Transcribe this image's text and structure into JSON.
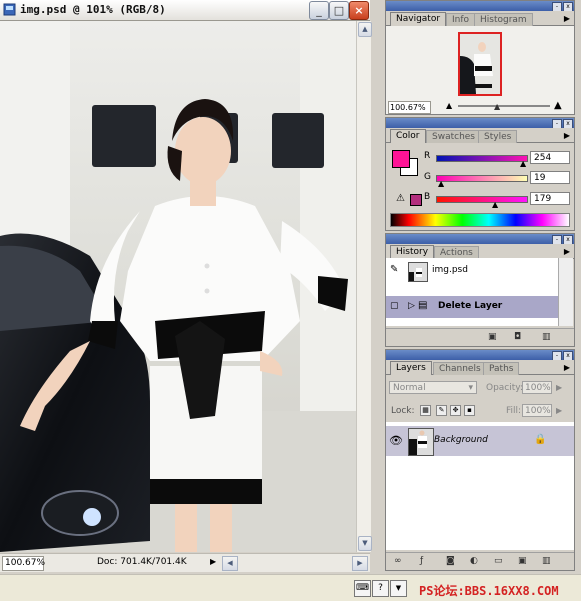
{
  "document": {
    "title": "img.psd @ 101% (RGB/8)",
    "zoom": "100.67%",
    "doc_size": "Doc: 701.4K/701.4K",
    "buttons": {
      "minimize": "_",
      "maximize": "□",
      "close": "×"
    }
  },
  "navigator": {
    "tabs": [
      "Navigator",
      "Info",
      "Histogram"
    ],
    "zoom": "100.67%"
  },
  "color": {
    "tabs": [
      "Color",
      "Swatches",
      "Styles"
    ],
    "channels": [
      {
        "label": "R",
        "value": "254"
      },
      {
        "label": "G",
        "value": "19"
      },
      {
        "label": "B",
        "value": "179"
      }
    ],
    "foreground": "#fe1396",
    "background": "#ffffff",
    "gamut_warning_color": "#b32e7e"
  },
  "history": {
    "tabs": [
      "History",
      "Actions"
    ],
    "items": [
      {
        "label": "img.psd",
        "selected": false
      },
      {
        "label": "Delete Layer",
        "selected": true
      }
    ]
  },
  "layers": {
    "tabs": [
      "Layers",
      "Channels",
      "Paths"
    ],
    "blend_mode": "Normal",
    "opacity_label": "Opacity:",
    "opacity": "100%",
    "lock_label": "Lock:",
    "fill_label": "Fill:",
    "fill": "100%",
    "items": [
      {
        "name": "Background",
        "visible": true,
        "locked": true
      }
    ]
  },
  "watermark": "PS论坛:BBS.16XX8.COM"
}
